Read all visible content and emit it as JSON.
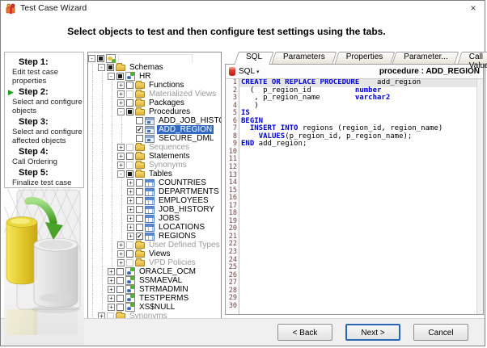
{
  "window": {
    "title": "Test Case Wizard",
    "close_glyph": "×"
  },
  "header": {
    "instruction": "Select objects to test and then configure test settings using the tabs."
  },
  "steps": {
    "items": [
      {
        "label": "Step 1:",
        "desc": "Edit test case properties",
        "active": false
      },
      {
        "label": "Step 2:",
        "desc": "Select and configure objects",
        "active": true
      },
      {
        "label": "Step 3:",
        "desc": "Select and configure affected objects",
        "active": false
      },
      {
        "label": "Step 4:",
        "desc": "Call Ordering",
        "active": false
      },
      {
        "label": "Step 5:",
        "desc": "Finalize test case",
        "active": false
      }
    ]
  },
  "tree": {
    "items": [
      {
        "indent": 0,
        "expand": "open",
        "checkbox": "partial",
        "icon": "conn",
        "label": "",
        "disabled": false,
        "selected": false
      },
      {
        "indent": 1,
        "expand": "open",
        "checkbox": "partial",
        "icon": "folder",
        "label": "Schemas",
        "disabled": false,
        "selected": false
      },
      {
        "indent": 2,
        "expand": "open",
        "checkbox": "partial",
        "icon": "schema",
        "label": "HR",
        "disabled": false,
        "selected": false
      },
      {
        "indent": 3,
        "expand": "closed",
        "checkbox": "empty",
        "icon": "folder",
        "label": "Functions",
        "disabled": false,
        "selected": false
      },
      {
        "indent": 3,
        "expand": "closed",
        "checkbox": "disabled",
        "icon": "folder",
        "label": "Materialized Views",
        "disabled": true,
        "selected": false
      },
      {
        "indent": 3,
        "expand": "closed",
        "checkbox": "empty",
        "icon": "folder",
        "label": "Packages",
        "disabled": false,
        "selected": false
      },
      {
        "indent": 3,
        "expand": "open",
        "checkbox": "partial",
        "icon": "folder",
        "label": "Procedures",
        "disabled": false,
        "selected": false
      },
      {
        "indent": 4,
        "expand": null,
        "checkbox": "empty",
        "icon": "proc",
        "label": "ADD_JOB_HISTORY",
        "disabled": false,
        "selected": false
      },
      {
        "indent": 4,
        "expand": null,
        "checkbox": "checked",
        "icon": "proc",
        "label": "ADD_REGION",
        "disabled": false,
        "selected": true
      },
      {
        "indent": 4,
        "expand": null,
        "checkbox": "empty",
        "icon": "proc",
        "label": "SECURE_DML",
        "disabled": false,
        "selected": false
      },
      {
        "indent": 3,
        "expand": "closed",
        "checkbox": "disabled",
        "icon": "folder",
        "label": "Sequences",
        "disabled": true,
        "selected": false
      },
      {
        "indent": 3,
        "expand": "closed",
        "checkbox": "empty",
        "icon": "folder",
        "label": "Statements",
        "disabled": false,
        "selected": false
      },
      {
        "indent": 3,
        "expand": "closed",
        "checkbox": "disabled",
        "icon": "folder",
        "label": "Synonyms",
        "disabled": true,
        "selected": false
      },
      {
        "indent": 3,
        "expand": "open",
        "checkbox": "partial",
        "icon": "folder",
        "label": "Tables",
        "disabled": false,
        "selected": false
      },
      {
        "indent": 4,
        "expand": "closed",
        "checkbox": "empty",
        "icon": "table",
        "label": "COUNTRIES",
        "disabled": false,
        "selected": false
      },
      {
        "indent": 4,
        "expand": "closed",
        "checkbox": "empty",
        "icon": "table",
        "label": "DEPARTMENTS",
        "disabled": false,
        "selected": false
      },
      {
        "indent": 4,
        "expand": "closed",
        "checkbox": "empty",
        "icon": "table",
        "label": "EMPLOYEES",
        "disabled": false,
        "selected": false
      },
      {
        "indent": 4,
        "expand": "closed",
        "checkbox": "empty",
        "icon": "table",
        "label": "JOB_HISTORY",
        "disabled": false,
        "selected": false
      },
      {
        "indent": 4,
        "expand": "closed",
        "checkbox": "empty",
        "icon": "table",
        "label": "JOBS",
        "disabled": false,
        "selected": false
      },
      {
        "indent": 4,
        "expand": "closed",
        "checkbox": "empty",
        "icon": "table",
        "label": "LOCATIONS",
        "disabled": false,
        "selected": false
      },
      {
        "indent": 4,
        "expand": "closed",
        "checkbox": "checked",
        "icon": "table",
        "label": "REGIONS",
        "disabled": false,
        "selected": false
      },
      {
        "indent": 3,
        "expand": "closed",
        "checkbox": "disabled",
        "icon": "folder",
        "label": "User Defined Types",
        "disabled": true,
        "selected": false
      },
      {
        "indent": 3,
        "expand": "closed",
        "checkbox": "empty",
        "icon": "folder",
        "label": "Views",
        "disabled": false,
        "selected": false
      },
      {
        "indent": 3,
        "expand": "closed",
        "checkbox": "disabled",
        "icon": "folder",
        "label": "VPD Policies",
        "disabled": true,
        "selected": false
      },
      {
        "indent": 2,
        "expand": "closed",
        "checkbox": "empty",
        "icon": "schema",
        "label": "ORACLE_OCM",
        "disabled": false,
        "selected": false
      },
      {
        "indent": 2,
        "expand": "closed",
        "checkbox": "empty",
        "icon": "schema",
        "label": "SSMAEVAL",
        "disabled": false,
        "selected": false
      },
      {
        "indent": 2,
        "expand": "closed",
        "checkbox": "empty",
        "icon": "schema",
        "label": "STRMADMIN",
        "disabled": false,
        "selected": false
      },
      {
        "indent": 2,
        "expand": "closed",
        "checkbox": "empty",
        "icon": "schema",
        "label": "TESTPERMS",
        "disabled": false,
        "selected": false
      },
      {
        "indent": 2,
        "expand": "closed",
        "checkbox": "empty",
        "icon": "schema",
        "label": "XS$NULL",
        "disabled": false,
        "selected": false
      },
      {
        "indent": 1,
        "expand": "closed",
        "checkbox": "disabled",
        "icon": "folder",
        "label": "Synonyms",
        "disabled": true,
        "selected": false
      }
    ]
  },
  "tabs": [
    {
      "label": "SQL",
      "active": true
    },
    {
      "label": "Parameters",
      "active": false
    },
    {
      "label": "Properties",
      "active": false
    },
    {
      "label": "Parameter...",
      "active": false
    },
    {
      "label": "Call Values",
      "active": false
    }
  ],
  "editor": {
    "toolbar": {
      "dropdown_label": "SQL",
      "caret": "▾",
      "context_label": "procedure : ADD_REGION"
    },
    "total_lines": 30,
    "lines": [
      [
        {
          "c": "kw",
          "t": "CREATE OR REPLACE PROCEDURE"
        },
        {
          "c": "pl",
          "t": "    add_region"
        }
      ],
      [
        {
          "c": "pl",
          "t": "  (  p_region_id          "
        },
        {
          "c": "kw",
          "t": "number"
        }
      ],
      [
        {
          "c": "pl",
          "t": "   , p_region_name        "
        },
        {
          "c": "kw",
          "t": "varchar2"
        }
      ],
      [
        {
          "c": "pl",
          "t": "   )"
        }
      ],
      [
        {
          "c": "kw",
          "t": "IS"
        }
      ],
      [
        {
          "c": "kw",
          "t": "BEGIN"
        }
      ],
      [
        {
          "c": "pl",
          "t": "  "
        },
        {
          "c": "kw",
          "t": "INSERT INTO"
        },
        {
          "c": "pl",
          "t": " regions (region_id, region_name)"
        }
      ],
      [
        {
          "c": "pl",
          "t": "    "
        },
        {
          "c": "kw",
          "t": "VALUES"
        },
        {
          "c": "pl",
          "t": "(p_region_id, p_region_name);"
        }
      ],
      [
        {
          "c": "kw",
          "t": "END"
        },
        {
          "c": "pl",
          "t": " add_region;"
        }
      ]
    ]
  },
  "footer": {
    "back_label": "< Back",
    "next_label": "Next >",
    "cancel_label": "Cancel"
  },
  "colors": {
    "selection_blue": "#316ac5",
    "keyword_blue": "#0000cc",
    "line_number": "#774444",
    "step_arrow_green": "#1e9e1e",
    "folder_gold": "#e0b33c"
  }
}
